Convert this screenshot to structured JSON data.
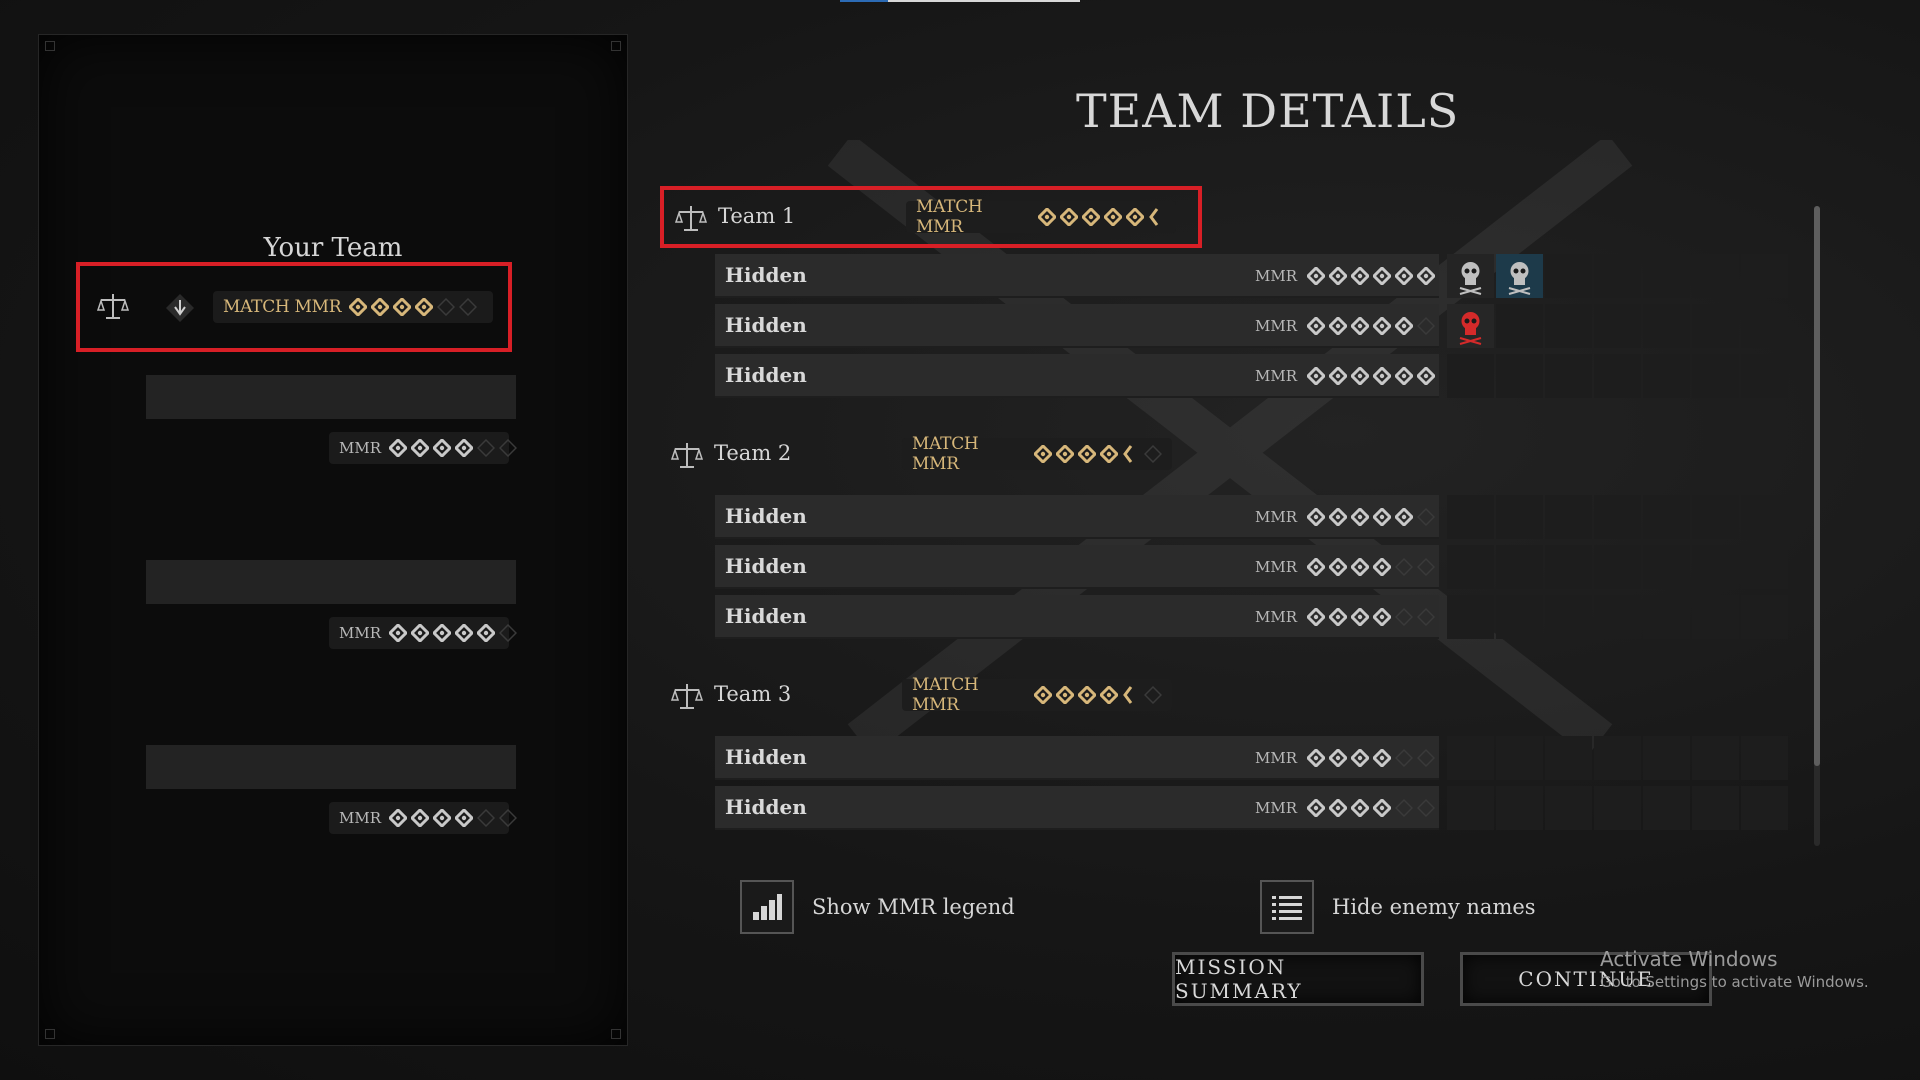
{
  "page_title": "TEAM DETAILS",
  "your_team": {
    "title": "Your Team",
    "match_label": "MATCH MMR",
    "match_stars": 4,
    "players": [
      {
        "name": "",
        "mmr_label": "MMR",
        "stars": 4
      },
      {
        "name": "",
        "mmr_label": "MMR",
        "stars": 5
      },
      {
        "name": "",
        "mmr_label": "MMR",
        "stars": 4
      }
    ]
  },
  "teams": [
    {
      "name": "Team 1",
      "match_label": "MATCH MMR",
      "match_stars": 5.5,
      "players": [
        {
          "name": "Hidden",
          "mmr_label": "MMR",
          "stars": 6,
          "slots": [
            "skull",
            "skull-blue"
          ]
        },
        {
          "name": "Hidden",
          "mmr_label": "MMR",
          "stars": 5,
          "slots": [
            "skull-red"
          ]
        },
        {
          "name": "Hidden",
          "mmr_label": "MMR",
          "stars": 6,
          "slots": []
        }
      ]
    },
    {
      "name": "Team 2",
      "match_label": "MATCH MMR",
      "match_stars": 4.5,
      "players": [
        {
          "name": "Hidden",
          "mmr_label": "MMR",
          "stars": 5,
          "slots": []
        },
        {
          "name": "Hidden",
          "mmr_label": "MMR",
          "stars": 4,
          "slots": []
        },
        {
          "name": "Hidden",
          "mmr_label": "MMR",
          "stars": 4,
          "slots": []
        }
      ]
    },
    {
      "name": "Team 3",
      "match_label": "MATCH MMR",
      "match_stars": 4.5,
      "players": [
        {
          "name": "Hidden",
          "mmr_label": "MMR",
          "stars": 4,
          "slots": []
        },
        {
          "name": "Hidden",
          "mmr_label": "MMR",
          "stars": 4,
          "slots": []
        }
      ]
    }
  ],
  "options": {
    "show_legend": "Show MMR legend",
    "hide_names": "Hide enemy names"
  },
  "buttons": {
    "mission_summary": "MISSION SUMMARY",
    "continue": "CONTINUE"
  },
  "watermark": {
    "line1": "Activate Windows",
    "line2": "Go to Settings to activate Windows."
  },
  "colors": {
    "highlight": "#d81f26",
    "gold": "#d7b77a",
    "silver": "#c9c9c9"
  }
}
